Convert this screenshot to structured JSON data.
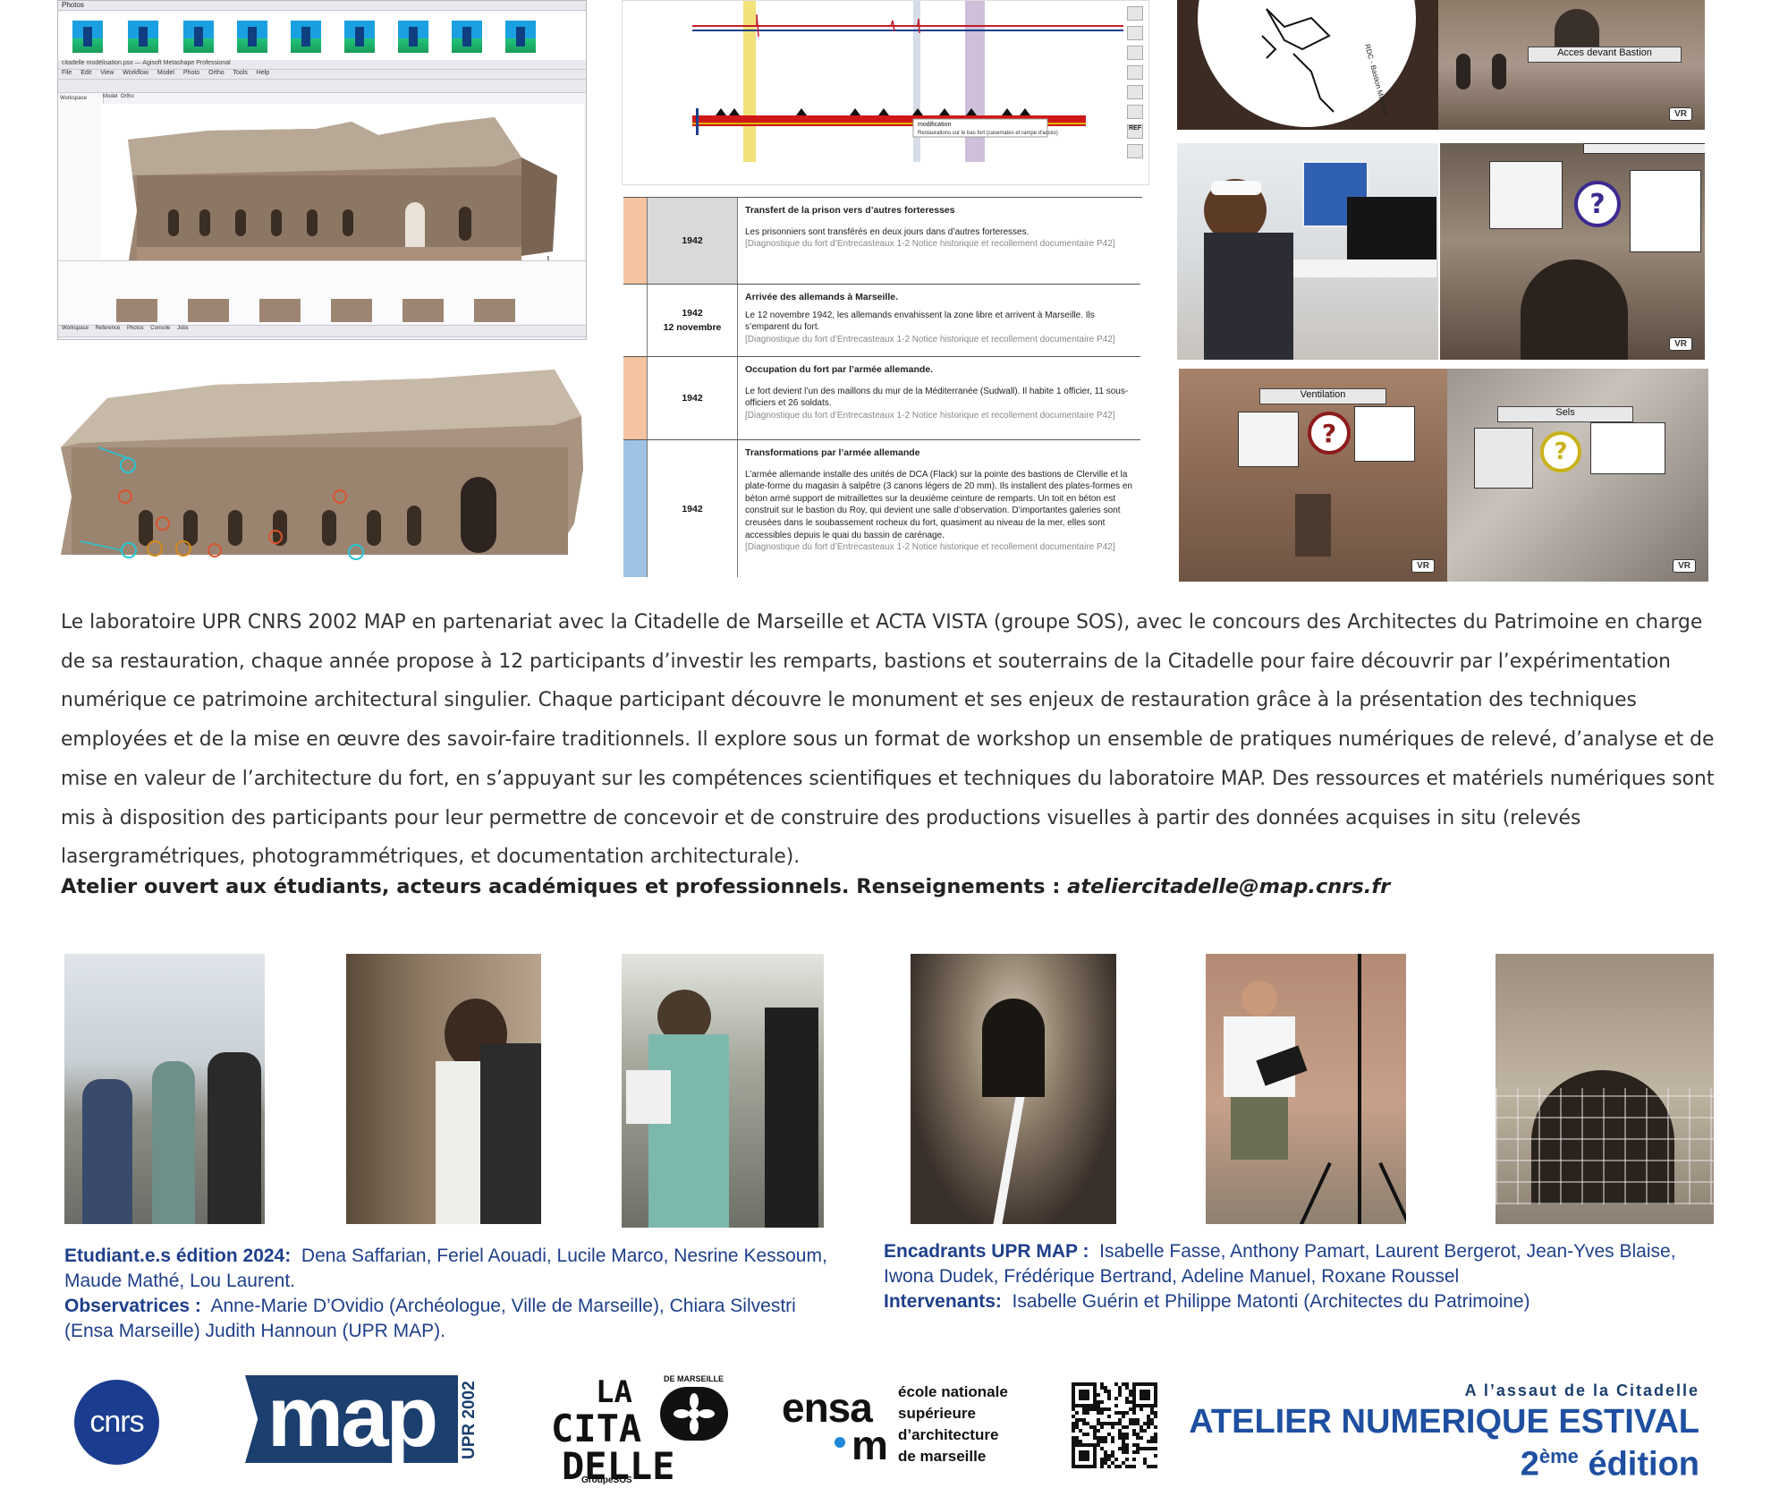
{
  "software": {
    "photos_label": "Photos",
    "window_title": "citadelle modélisation.psx — Agisoft Metashape Professional",
    "menu": [
      "File",
      "Edit",
      "View",
      "Workflow",
      "Model",
      "Photo",
      "Ortho",
      "Tools",
      "Help"
    ],
    "workspace_tab": "Workspace",
    "model_tab": "Model",
    "ortho_tab": "Ortho",
    "bottom_tabs": [
      "Workspace",
      "Reference",
      "Photos",
      "Console",
      "Jobs"
    ]
  },
  "timeline_chart": {
    "labels": [
      "modification",
      "Restaurations sur le bas fort (casemates et rampe d'accès)"
    ],
    "tool_label": "REF"
  },
  "timeline_table": {
    "rows": [
      {
        "color": "#f4c3a0",
        "date": "1942",
        "date2": "",
        "title": "Transfert de la prison vers d’autres forteresses",
        "text": "Les prisonniers sont transférés en deux jours dans d’autres forteresses.",
        "ref": "[Diagnostique du fort d’Entrecasteaux 1-2 Notice historique et recollement documentaire P42]"
      },
      {
        "color": "#ffffff",
        "date": "1942",
        "date2": "12 novembre",
        "title": "Arrivée des allemands à Marseille.",
        "text": "Le 12 novembre 1942, les allemands envahissent la zone libre et arrivent à Marseille. Ils s’emparent du fort.",
        "ref": "[Diagnostique du fort d’Entrecasteaux 1-2 Notice historique et recollement documentaire P42]"
      },
      {
        "color": "#f4c3a0",
        "date": "1942",
        "date2": "",
        "title": "Occupation du fort par l’armée allemande.",
        "text": "Le fort devient l’un des maillons du mur de la Méditerranée (Sudwall). Il habite 1 officier, 11 sous-officiers et 26 soldats.",
        "ref": "[Diagnostique du fort d’Entrecasteaux 1-2 Notice historique et recollement documentaire P42]"
      },
      {
        "color": "#9ec3e6",
        "date": "1942",
        "date2": "",
        "title": "Transformations par l’armée allemande",
        "text": "L’armée allemande installe des unités de DCA (Flack) sur la pointe des bastions de Clerville et la plate-forme du magasin à salpêtre (3 canons légers de 20 mm). Ils installent des plates-formes en béton armé support de mitraillettes sur la deuxième ceinture de remparts. Un toit en béton est construit sur le bastion du Roy, qui devient une salle d’observation. D’importantes galeries sont creusées dans le soubassement rocheux du fort, quasiment au niveau de la mer, elles sont accessibles depuis le quai du bassin de carénage.",
        "ref": "[Diagnostique du fort d’Entrecasteaux 1-2 Notice historique et recollement documentaire P42]"
      }
    ]
  },
  "vr_panels": {
    "map_label": "RDC - Bastion Mazarin",
    "acces_label": "Acces devant Bastion",
    "ventilation_label": "Ventilation",
    "sels_label": "Sels",
    "vr_badge": "VR",
    "qmark": "?"
  },
  "description": {
    "paragraph": "Le laboratoire UPR CNRS 2002 MAP en partenariat avec la Citadelle de Marseille et ACTA  VISTA (groupe SOS), avec le concours des Architectes du Patrimoine en charge de sa  restauration, chaque année propose à 12 participants d’investir les remparts, bastions et souterrains de la  Citadelle pour faire découvrir par l’expérimentation numérique ce patrimoine architectural singulier. Chaque participant découvre le monument et ses enjeux de restauration grâce à la  présentation des techniques employées et de la mise en œuvre des savoir-faire  traditionnels. Il explore sous un format de workshop un ensemble de pratiques numériques  de relevé, d’analyse et de mise en valeur de l’architecture du fort, en s’appuyant sur les compétences scientifiques et techniques du laboratoire MAP. Des ressources et matériels numériques sont mis à disposition des participants pour leur permettre de concevoir et de  construire des productions visuelles à partir des données acquises in situ (relevés lasergramétriques, photogrammétriques, et documentation architecturale).",
    "open_line": "Atelier ouvert aux étudiants, acteurs académiques et professionnels. Renseignements : ",
    "email": "ateliercitadelle@map.cnrs.fr"
  },
  "credits_left": {
    "students_label": "Etudiant.e.s édition 2024:",
    "students": "Dena Saffarian, Feriel Aouadi, Lucile Marco, Nesrine Kessoum, Maude Mathé, Lou Laurent.",
    "observers_label": "Observatrices :",
    "observers": "Anne-Marie D’Ovidio (Archéologue, Ville de Marseille), Chiara Silvestri (Ensa Marseille) Judith Hannoun (UPR MAP)."
  },
  "credits_right": {
    "supervisors_label": "Encadrants UPR MAP :",
    "supervisors": "Isabelle Fasse, Anthony Pamart, Laurent Bergerot, Jean-Yves Blaise, Iwona Dudek, Frédérique Bertrand, Adeline Manuel, Roxane Roussel",
    "speakers_label": "Intervenants:",
    "speakers": "Isabelle Guérin et Philippe Matonti (Architectes du Patrimoine)"
  },
  "logos": {
    "cnrs": "cnrs",
    "map": "map",
    "map_upr": "UPR 2002",
    "citadelle_l1": "LA",
    "citadelle_l2": "CITA",
    "citadelle_l3": "DELLE",
    "citadelle_sub": "DE MARSEILLE",
    "citadelle_group": "GroupeSOS",
    "ensa_top": "ensa",
    "ensa_bottom": "m",
    "ensa_lines": [
      "école nationale",
      "supérieure",
      "d’architecture",
      "de marseille"
    ]
  },
  "event": {
    "tagline": "A l’assaut de la Citadelle",
    "title": "ATELIER NUMERIQUE ESTIVAL",
    "edition_num": "2",
    "edition_sup": "ème",
    "edition_word": "édition"
  }
}
